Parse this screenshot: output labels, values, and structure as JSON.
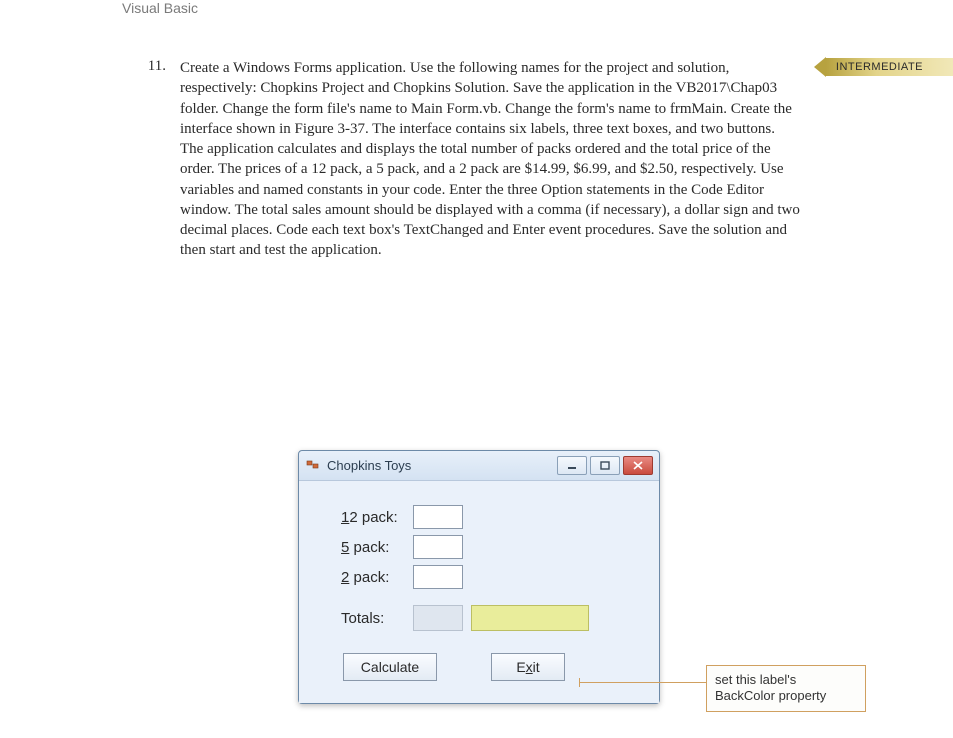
{
  "header": "Visual Basic",
  "difficulty": "INTERMEDIATE",
  "exercise": {
    "number": "11.",
    "text": "Create a Windows Forms application. Use the following names for the project and solution, respectively: Chopkins Project and Chopkins Solution. Save the application in the VB2017\\Chap03 folder. Change the form file's name to Main Form.vb. Change the form's name to frmMain. Create the interface shown in Figure 3-37. The interface contains six labels, three text boxes, and two buttons. The application calculates and displays the total number of packs ordered and the total price of the order. The prices of a 12 pack, a 5 pack, and a 2 pack are $14.99, $6.99, and $2.50, respectively. Use variables and named constants in your code. Enter the three Option statements in the Code Editor window. The total sales amount should be displayed with a comma (if necessary), a dollar sign and two decimal places. Code each text box's TextChanged and Enter event procedures. Save the solution and then start and test the application."
  },
  "form": {
    "title": "Chopkins Toys",
    "labels": {
      "pack12_pre": "1",
      "pack12_post": "2 pack:",
      "pack5_pre": "5",
      "pack5_post": " pack:",
      "pack2_pre": "2",
      "pack2_post": " pack:",
      "totals": "Totals:"
    },
    "buttons": {
      "calculate_pre": "C",
      "calculate_post": "alculate",
      "exit_pre": "E",
      "exit_post": "xit"
    },
    "window_controls": {
      "minimize": "min",
      "maximize": "max",
      "close": "close"
    }
  },
  "callout": {
    "line1": "set this label's",
    "line2": "BackColor property"
  }
}
